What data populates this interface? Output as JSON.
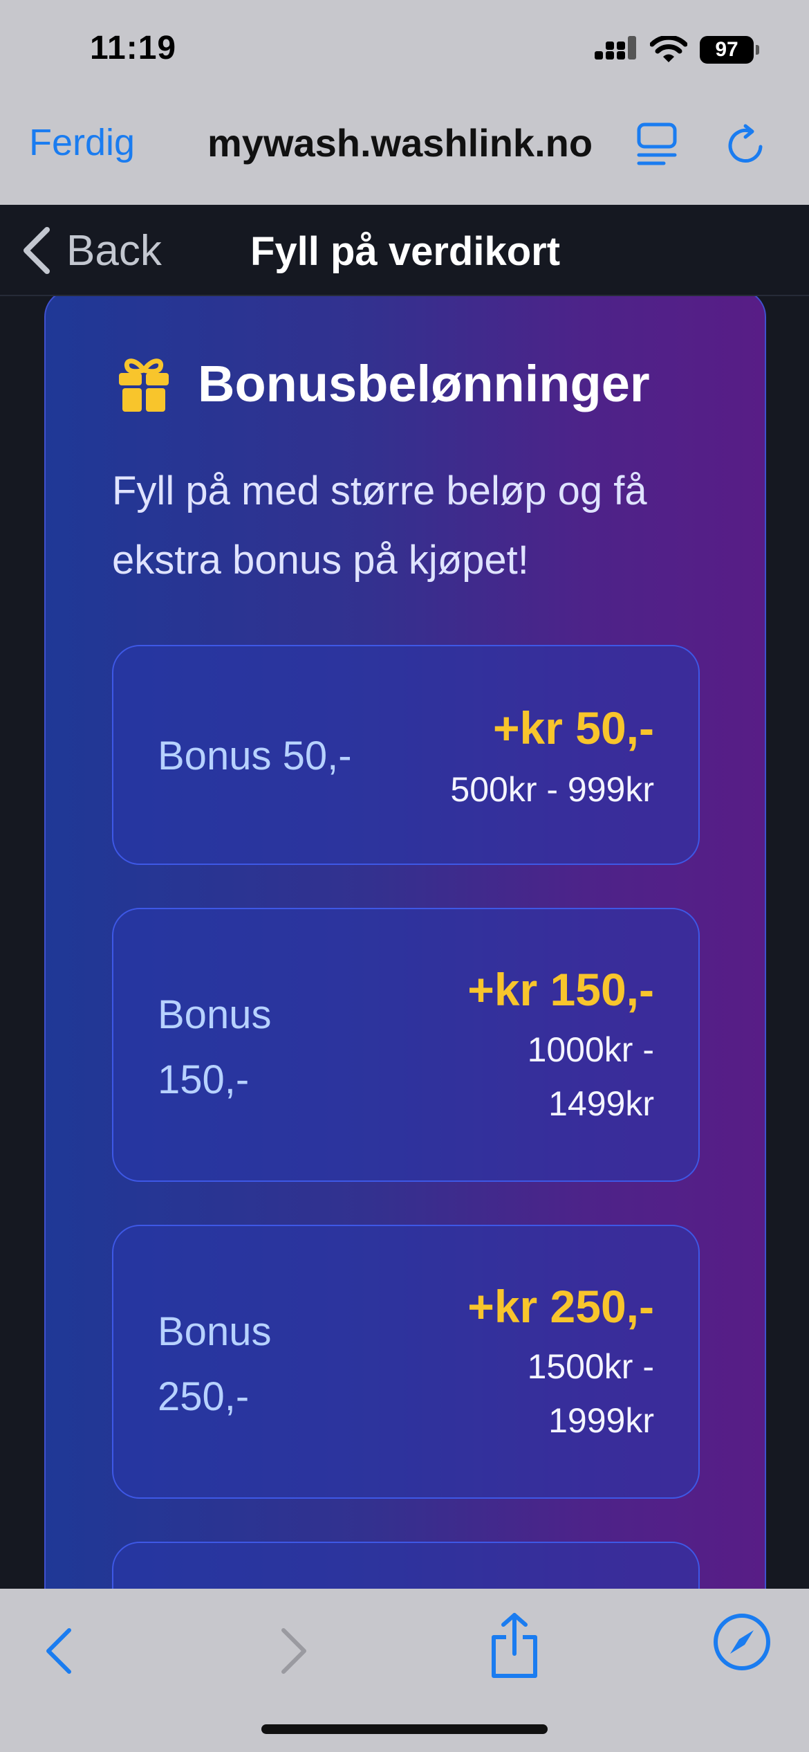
{
  "status_bar": {
    "time": "11:19",
    "battery": "97"
  },
  "browser": {
    "done_label": "Ferdig",
    "url": "mywash.washlink.no"
  },
  "app_nav": {
    "back_label": "Back",
    "title": "Fyll på verdikort"
  },
  "bonus": {
    "title": "Bonusbelønninger",
    "description": "Fyll på med større beløp og få ekstra bonus på kjøpet!",
    "tiers": [
      {
        "name": "Bonus 50,-",
        "amount": "+kr 50,-",
        "range": "500kr - 999kr"
      },
      {
        "name": "Bonus 150,-",
        "amount": "+kr 150,-",
        "range": "1000kr - 1499kr"
      },
      {
        "name": "Bonus 250,-",
        "amount": "+kr 250,-",
        "range": "1500kr - 1999kr"
      }
    ]
  },
  "colors": {
    "accent": "#1a7cf0",
    "bonus_amount": "#f8c52c",
    "gift": "#f8c52c"
  },
  "icons": [
    "signal-icon",
    "wifi-icon",
    "battery-icon",
    "reader-icon",
    "reload-icon",
    "chevron-left-icon",
    "gift-icon",
    "back-arrow-icon",
    "forward-arrow-icon",
    "share-icon",
    "compass-icon"
  ]
}
